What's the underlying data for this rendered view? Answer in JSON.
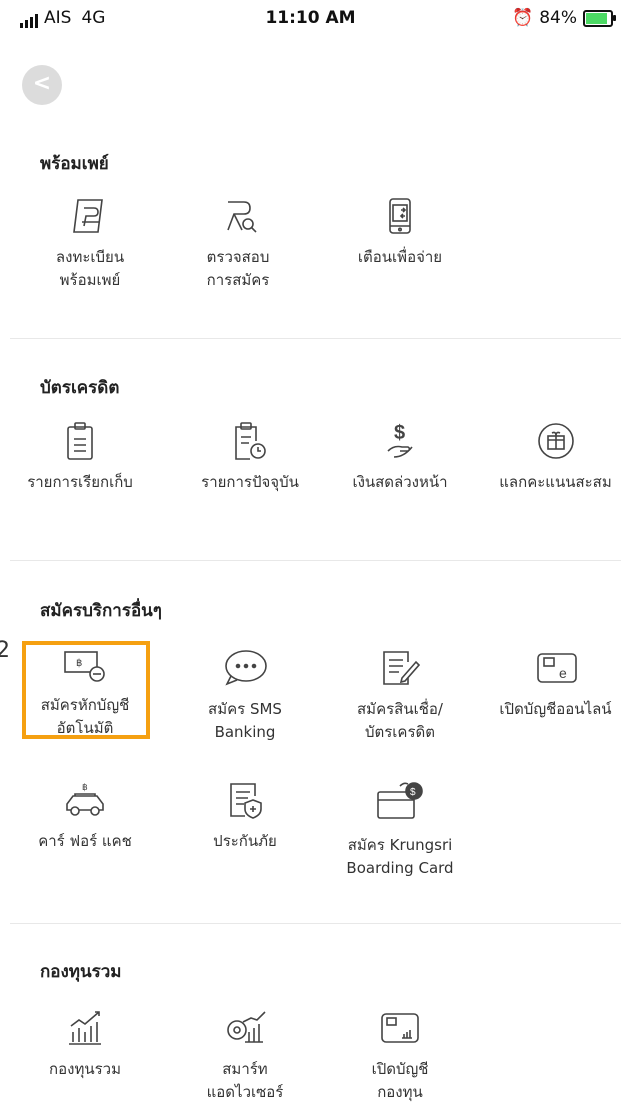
{
  "status_bar": {
    "carrier": "AIS",
    "network": "4G",
    "time": "11:10 AM",
    "battery": "84%"
  },
  "back_label": "<",
  "side_number": "2",
  "sections": {
    "promptpay": {
      "title": "พร้อมเพย์",
      "items": [
        {
          "line1": "ลงทะเบียน",
          "line2": "พร้อมเพย์",
          "icon": "promptpay-register-icon"
        },
        {
          "line1": "ตรวจสอบ",
          "line2": "การสมัคร",
          "icon": "promptpay-check-icon"
        },
        {
          "line1": "เตือนเพื่อจ่าย",
          "line2": "",
          "icon": "payment-reminder-icon"
        }
      ]
    },
    "credit_card": {
      "title": "บัตรเครดิต",
      "items": [
        {
          "line1": "รายการเรียกเก็บ",
          "icon": "billing-statement-icon"
        },
        {
          "line1": "รายการปัจจุบัน",
          "icon": "current-transactions-icon"
        },
        {
          "line1": "เงินสดล่วงหน้า",
          "icon": "cash-advance-icon"
        },
        {
          "line1": "แลกคะแนนสะสม",
          "icon": "redeem-points-icon"
        }
      ]
    },
    "other_services": {
      "title": "สมัครบริการอื่นๆ",
      "items": [
        {
          "line1": "สมัครหักบัญชี",
          "line2": "อัตโนมัติ",
          "icon": "auto-debit-icon"
        },
        {
          "line1": "สมัคร SMS",
          "line2": "Banking",
          "icon": "sms-banking-icon"
        },
        {
          "line1": "สมัครสินเชื่อ/",
          "line2": "บัตรเครดิต",
          "icon": "loan-application-icon"
        },
        {
          "line1": "เปิดบัญชีออนไลน์",
          "line2": "",
          "icon": "open-account-icon"
        },
        {
          "line1": "คาร์ ฟอร์ แคช",
          "line2": "",
          "icon": "car-for-cash-icon"
        },
        {
          "line1": "ประกันภัย",
          "line2": "",
          "icon": "insurance-icon"
        },
        {
          "line1": "สมัคร Krungsri",
          "line2": "Boarding Card",
          "icon": "boarding-card-icon"
        }
      ]
    },
    "mutual_fund": {
      "title": "กองทุนรวม",
      "items": [
        {
          "line1": "กองทุนรวม",
          "line2": "",
          "icon": "mutual-fund-icon"
        },
        {
          "line1": "สมาร์ท",
          "line2": "แอดไวเซอร์",
          "icon": "smart-advisor-icon"
        },
        {
          "line1": "เปิดบัญชี",
          "line2": "กองทุน",
          "icon": "open-fund-account-icon"
        }
      ]
    }
  }
}
